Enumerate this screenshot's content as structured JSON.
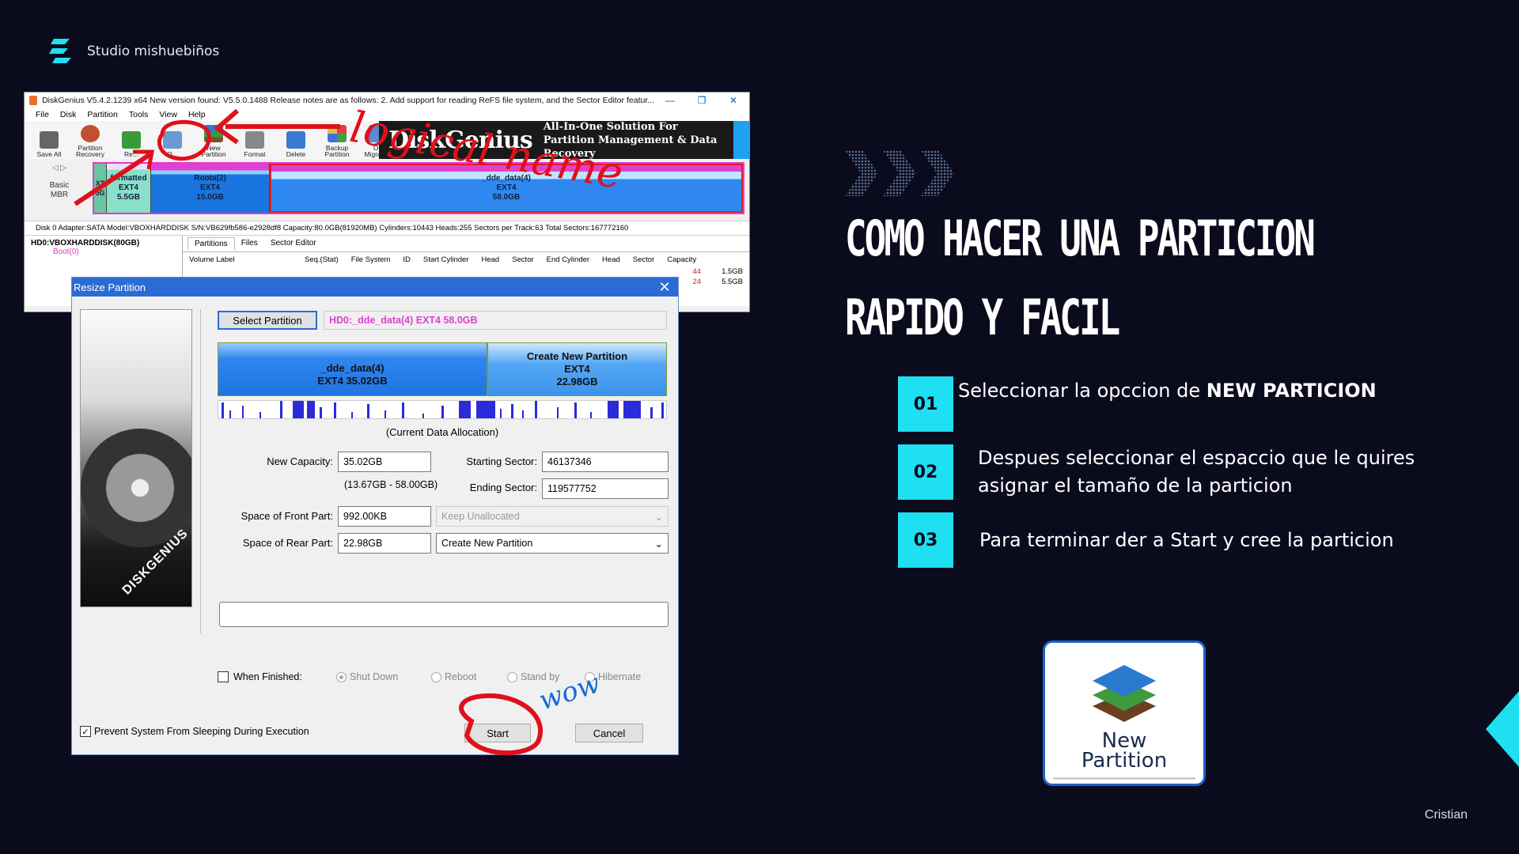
{
  "brand": {
    "name": "Studio mishuebiños"
  },
  "dg": {
    "title": "DiskGenius V5.4.2.1239 x64   New version found: V5.5.0.1488  Release notes are as follows: 2. Add support for reading ReFS file system, and the Sector Editor featur...",
    "menu": [
      "File",
      "Disk",
      "Partition",
      "Tools",
      "View",
      "Help"
    ],
    "tools": [
      "Save All",
      "Partition Recovery",
      "Re...",
      "Q...",
      "New Partition",
      "Format",
      "Delete",
      "Backup Partition",
      "OS Migration"
    ],
    "banner_title": "DiskGenius",
    "banner_sub1": "All-In-One Solution For",
    "banner_sub2": "Partition Management & Data Recovery",
    "basic": "Basic",
    "mbr": "MBR",
    "partitions": [
      {
        "name": "",
        "fs": "XT",
        "size": "5G"
      },
      {
        "name": "formatted",
        "fs": "EXT4",
        "size": "5.5GB"
      },
      {
        "name": "Roota(2)",
        "fs": "EXT4",
        "size": "15.0GB"
      },
      {
        "name": "_dde_data(4)",
        "fs": "EXT4",
        "size": "58.0GB"
      }
    ],
    "info": "Disk 0 Adapter:SATA  Model:VBOXHARDDISK  S/N:VB629fb586-e2928df8  Capacity:80.0GB(81920MB)  Cylinders:10443  Heads:255  Sectors per Track:63  Total Sectors:167772160",
    "tree_root": "HD0:VBOXHARDDISK(80GB)",
    "tree_boot": "Boot(0)",
    "tabs": [
      "Partitions",
      "Files",
      "Sector Editor"
    ],
    "columns": [
      "Volume Label",
      "Seq.(Stat)",
      "File System",
      "ID",
      "Start Cylinder",
      "Head",
      "Sector",
      "End Cylinder",
      "Head",
      "Sector",
      "Capacity"
    ],
    "row_vals": [
      {
        "a": "44",
        "b": "1.5GB"
      },
      {
        "a": "24",
        "b": "5.5GB"
      }
    ]
  },
  "rp": {
    "title": "Resize Partition",
    "select_btn": "Select Partition",
    "selected": "HD0:_dde_data(4) EXT4 58.0GB",
    "bar1_name": "_dde_data(4)",
    "bar1_info": "EXT4 35.02GB",
    "bar2_name": "Create New Partition",
    "bar2_fs": "EXT4",
    "bar2_size": "22.98GB",
    "alloc_label": "(Current Data Allocation)",
    "new_capacity_label": "New Capacity:",
    "new_capacity": "35.02GB",
    "range": "(13.67GB - 58.00GB)",
    "start_sector_label": "Starting Sector:",
    "start_sector": "46137346",
    "end_sector_label": "Ending Sector:",
    "end_sector": "119577752",
    "front_label": "Space of Front Part:",
    "front": "992.00KB",
    "front_opt": "Keep Unallocated",
    "rear_label": "Space of Rear Part:",
    "rear": "22.98GB",
    "rear_opt": "Create New Partition",
    "when_finished": "When Finished:",
    "opts": [
      "Shut Down",
      "Reboot",
      "Stand by",
      "Hibernate"
    ],
    "prevent": "Prevent System From Sleeping During Execution",
    "start_btn": "Start",
    "cancel_btn": "Cancel"
  },
  "annotations": {
    "top": "logical name",
    "wow": "wow"
  },
  "slide": {
    "title_line1": "COMO HACER UNA PARTICION",
    "title_line2": "RAPIDO Y FACIL",
    "steps": [
      {
        "num": "01",
        "pre": "Seleccionar la opccion de ",
        "bold": "NEW PARTICION"
      },
      {
        "num": "02",
        "line1": "Despues seleccionar  el espaccio que le quires",
        "line2": " asignar el tamaño de la particion"
      },
      {
        "num": "03",
        "text": "Para terminar der a Start  y cree  la particion"
      }
    ],
    "icon_label1": "New",
    "icon_label2": "Partition",
    "author": "Cristian"
  },
  "colors": {
    "bg": "#0b0b1e",
    "accent": "#1ee0f0",
    "annotation": "#e0101c"
  }
}
